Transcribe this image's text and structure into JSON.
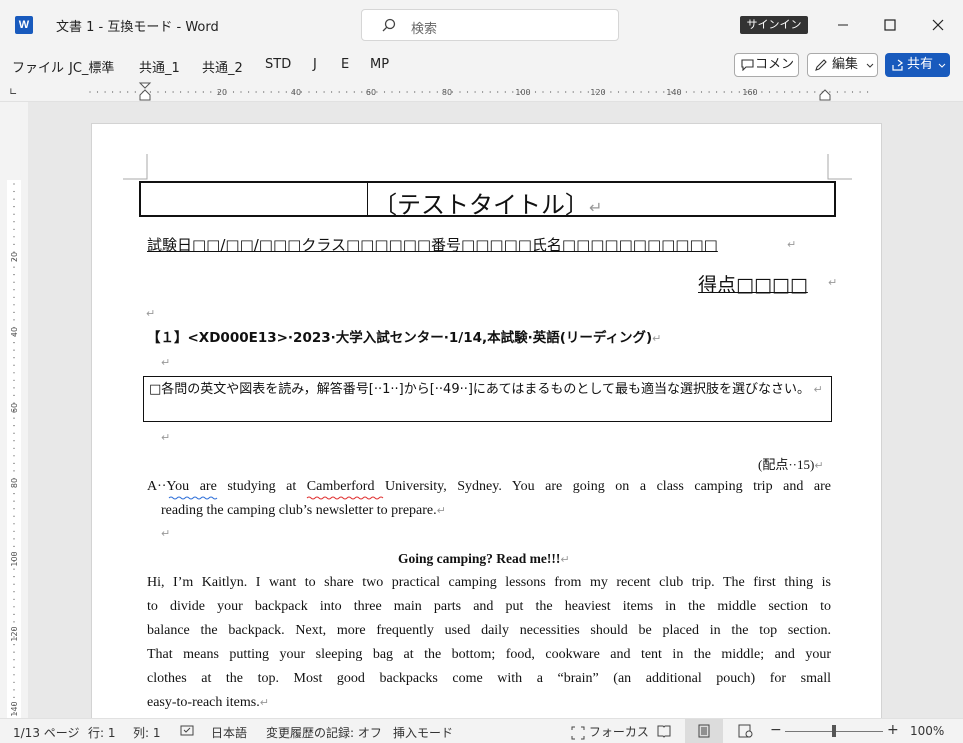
{
  "titlebar": {
    "app_icon_letter": "W",
    "doc_title": "文書 1  -  互換モード  -  Word",
    "search_placeholder": "検索",
    "signin_label": "サインイン"
  },
  "menu": {
    "items": [
      "ファイル",
      "JC_標準",
      "共通_1",
      "共通_2",
      "STD",
      "J",
      "E",
      "MP"
    ],
    "comment_label": "コメント",
    "edit_label": "編集",
    "share_label": "共有"
  },
  "ruler": {
    "h_labels": [
      "20",
      "40",
      "60",
      "80",
      "100",
      "120",
      "140",
      "160"
    ],
    "v_labels": [
      "20",
      "40",
      "60",
      "80",
      "100",
      "120",
      "140"
    ]
  },
  "document": {
    "title": "〔テストタイトル〕",
    "exam_line": "試験日□□/□□/□□□クラス□□□□□□番号□□□□□氏名□□□□□□□□□□□",
    "score_line": "得点□□□□",
    "question_header": "【１】<XD000E13>·2023·大学入試センター·1/14,本試験·英語(リーディング)",
    "instruction": "□各問の英文や図表を読み，解答番号[··1··]から[··49··]にあてはまるものとして最も適当な選択肢を選びなさい。",
    "points": "(配点··15)",
    "passage_a_line1": "A··You are studying at Camberford University, Sydney. You are going on a class camping trip and are",
    "passage_a_line2": "reading the camping club’s newsletter to prepare.",
    "heading": "Going camping? Read me!!!",
    "body_lines": [
      "Hi, I’m Kaitlyn. I want to share two practical camping lessons from my recent club trip. The first thing is",
      "to divide your backpack into three main parts and put the heaviest items in the middle section to",
      "balance the backpack. Next, more frequently used daily necessities should be placed in the top section.",
      "That means putting your sleeping bag at the bottom; food, cookware and tent in the middle; and your",
      "clothes at the top. Most good backpacks come with a “brain” (an additional pouch) for small"
    ],
    "last_line": "easy-to-reach items."
  },
  "status": {
    "page": "1/13 ページ",
    "row": "行: 1",
    "col": "列: 1",
    "language": "日本語",
    "track_changes": "変更履歴の記録: オフ",
    "insert_mode": "挿入モード",
    "focus": "フォーカス",
    "zoom_minus": "−",
    "zoom_plus": "+",
    "zoom": "100%"
  },
  "colors": {
    "accent": "#185abd",
    "paragraph_mark": "#999999"
  }
}
